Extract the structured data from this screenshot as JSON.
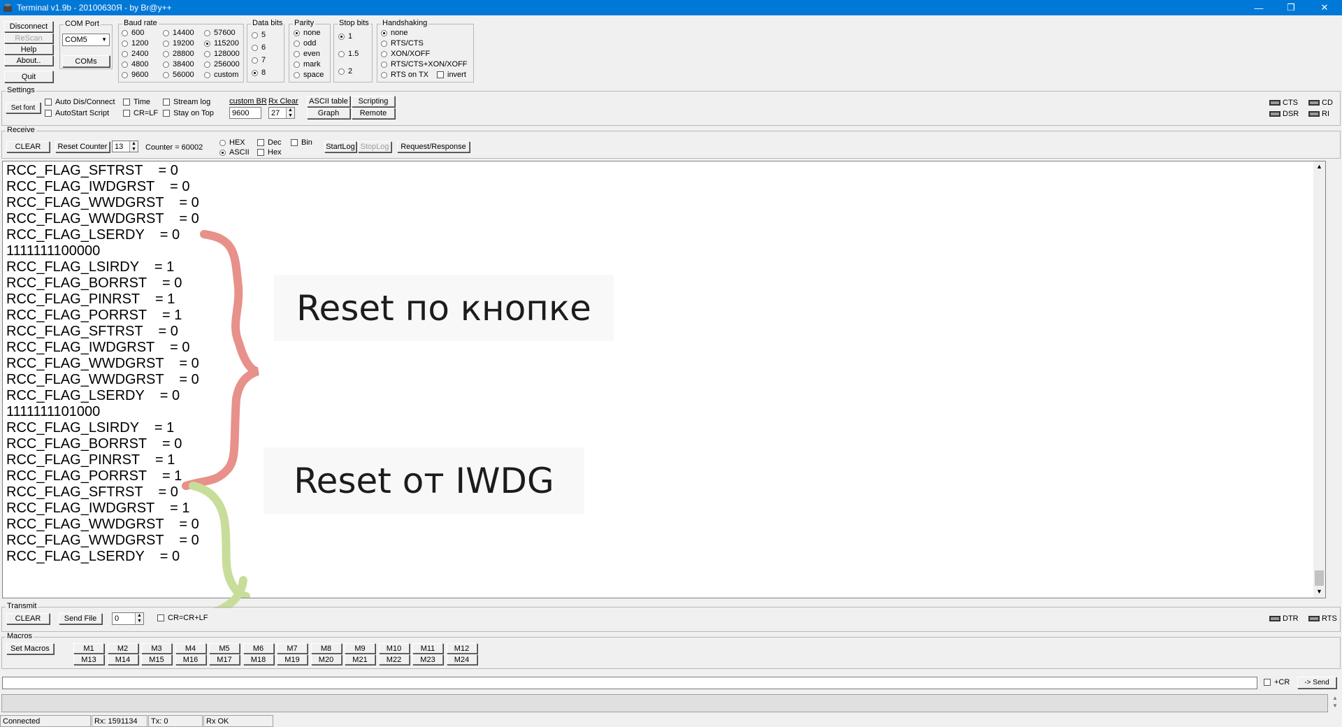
{
  "window": {
    "title": "Terminal v1.9b - 20100630Я - by Br@y++"
  },
  "conn_buttons": {
    "disconnect": "Disconnect",
    "rescan": "ReScan",
    "help": "Help",
    "about": "About..",
    "quit": "Quit"
  },
  "com_port": {
    "label": "COM Port",
    "value": "COM5",
    "coms_button": "COMs"
  },
  "baud": {
    "label": "Baud rate",
    "options": [
      [
        "600",
        "14400",
        "57600"
      ],
      [
        "1200",
        "19200",
        "115200"
      ],
      [
        "2400",
        "28800",
        "128000"
      ],
      [
        "4800",
        "38400",
        "256000"
      ],
      [
        "9600",
        "56000",
        "custom"
      ]
    ],
    "selected": "115200"
  },
  "data_bits": {
    "label": "Data bits",
    "options": [
      "5",
      "6",
      "7",
      "8"
    ],
    "selected": "8"
  },
  "parity": {
    "label": "Parity",
    "options": [
      "none",
      "odd",
      "even",
      "mark",
      "space"
    ],
    "selected": "none"
  },
  "stop_bits": {
    "label": "Stop bits",
    "options": [
      "1",
      "1.5",
      "2"
    ],
    "selected": "1"
  },
  "handshaking": {
    "label": "Handshaking",
    "options": [
      "none",
      "RTS/CTS",
      "XON/XOFF",
      "RTS/CTS+XON/XOFF",
      "RTS on TX"
    ],
    "invert": "invert",
    "selected": "none"
  },
  "settings": {
    "label": "Settings",
    "set_font": "Set font",
    "auto_dis_connect": "Auto Dis/Connect",
    "autostart_script": "AutoStart Script",
    "time": "Time",
    "cr_lf": "CR=LF",
    "stream_log": "Stream log",
    "stay_on_top": "Stay on Top",
    "custom_br_label": "custom BR",
    "custom_br_value": "9600",
    "rx_clear_label": "Rx Clear",
    "rx_clear_value": "27",
    "ascii_table": "ASCII table",
    "scripting": "Scripting",
    "graph": "Graph",
    "remote": "Remote"
  },
  "signals": {
    "cts": "CTS",
    "cd": "CD",
    "dsr": "DSR",
    "ri": "RI",
    "dtr": "DTR",
    "rts": "RTS"
  },
  "receive": {
    "label": "Receive",
    "clear": "CLEAR",
    "reset_counter": "Reset Counter",
    "counter_spin": "13",
    "counter_text": "Counter = 60002",
    "hex": "HEX",
    "ascii": "ASCII",
    "dec": "Dec",
    "hex2": "Hex",
    "bin": "Bin",
    "start_log": "StartLog",
    "stop_log": "StopLog",
    "request_response": "Request/Response"
  },
  "log_lines": [
    "RCC_FLAG_SFTRST    = 0",
    "RCC_FLAG_IWDGRST    = 0",
    "RCC_FLAG_WWDGRST    = 0",
    "RCC_FLAG_WWDGRST    = 0",
    "RCC_FLAG_LSERDY    = 0",
    "1111111100000",
    "RCC_FLAG_LSIRDY    = 1",
    "RCC_FLAG_BORRST    = 0",
    "RCC_FLAG_PINRST    = 1",
    "RCC_FLAG_PORRST    = 1",
    "RCC_FLAG_SFTRST    = 0",
    "RCC_FLAG_IWDGRST    = 0",
    "RCC_FLAG_WWDGRST    = 0",
    "RCC_FLAG_WWDGRST    = 0",
    "RCC_FLAG_LSERDY    = 0",
    "1111111101000",
    "RCC_FLAG_LSIRDY    = 1",
    "RCC_FLAG_BORRST    = 0",
    "RCC_FLAG_PINRST    = 1",
    "RCC_FLAG_PORRST    = 1",
    "RCC_FLAG_SFTRST    = 0",
    "RCC_FLAG_IWDGRST    = 1",
    "RCC_FLAG_WWDGRST    = 0",
    "RCC_FLAG_WWDGRST    = 0",
    "RCC_FLAG_LSERDY    = 0"
  ],
  "annotations": {
    "button_reset": "Reset по кнопке",
    "iwdg_reset": "Reset от IWDG",
    "brace_colors": {
      "button": "#e8908a",
      "iwdg": "#c9dd9a"
    }
  },
  "transmit": {
    "label": "Transmit",
    "clear": "CLEAR",
    "send_file": "Send File",
    "spin": "0",
    "cr_crlf": "CR=CR+LF"
  },
  "macros": {
    "label": "Macros",
    "set_macros": "Set Macros",
    "row1": [
      "M1",
      "M2",
      "M3",
      "M4",
      "M5",
      "M6",
      "M7",
      "M8",
      "M9",
      "M10",
      "M11",
      "M12"
    ],
    "row2": [
      "M13",
      "M14",
      "M15",
      "M16",
      "M17",
      "M18",
      "M19",
      "M20",
      "M21",
      "M22",
      "M23",
      "M24"
    ]
  },
  "send_bar": {
    "input_value": "",
    "plus_cr": "+CR",
    "send": "-> Send"
  },
  "status": {
    "state": "Connected",
    "rx": "Rx: 1591134",
    "tx": "Tx: 0",
    "rx_status": "Rx OK"
  }
}
